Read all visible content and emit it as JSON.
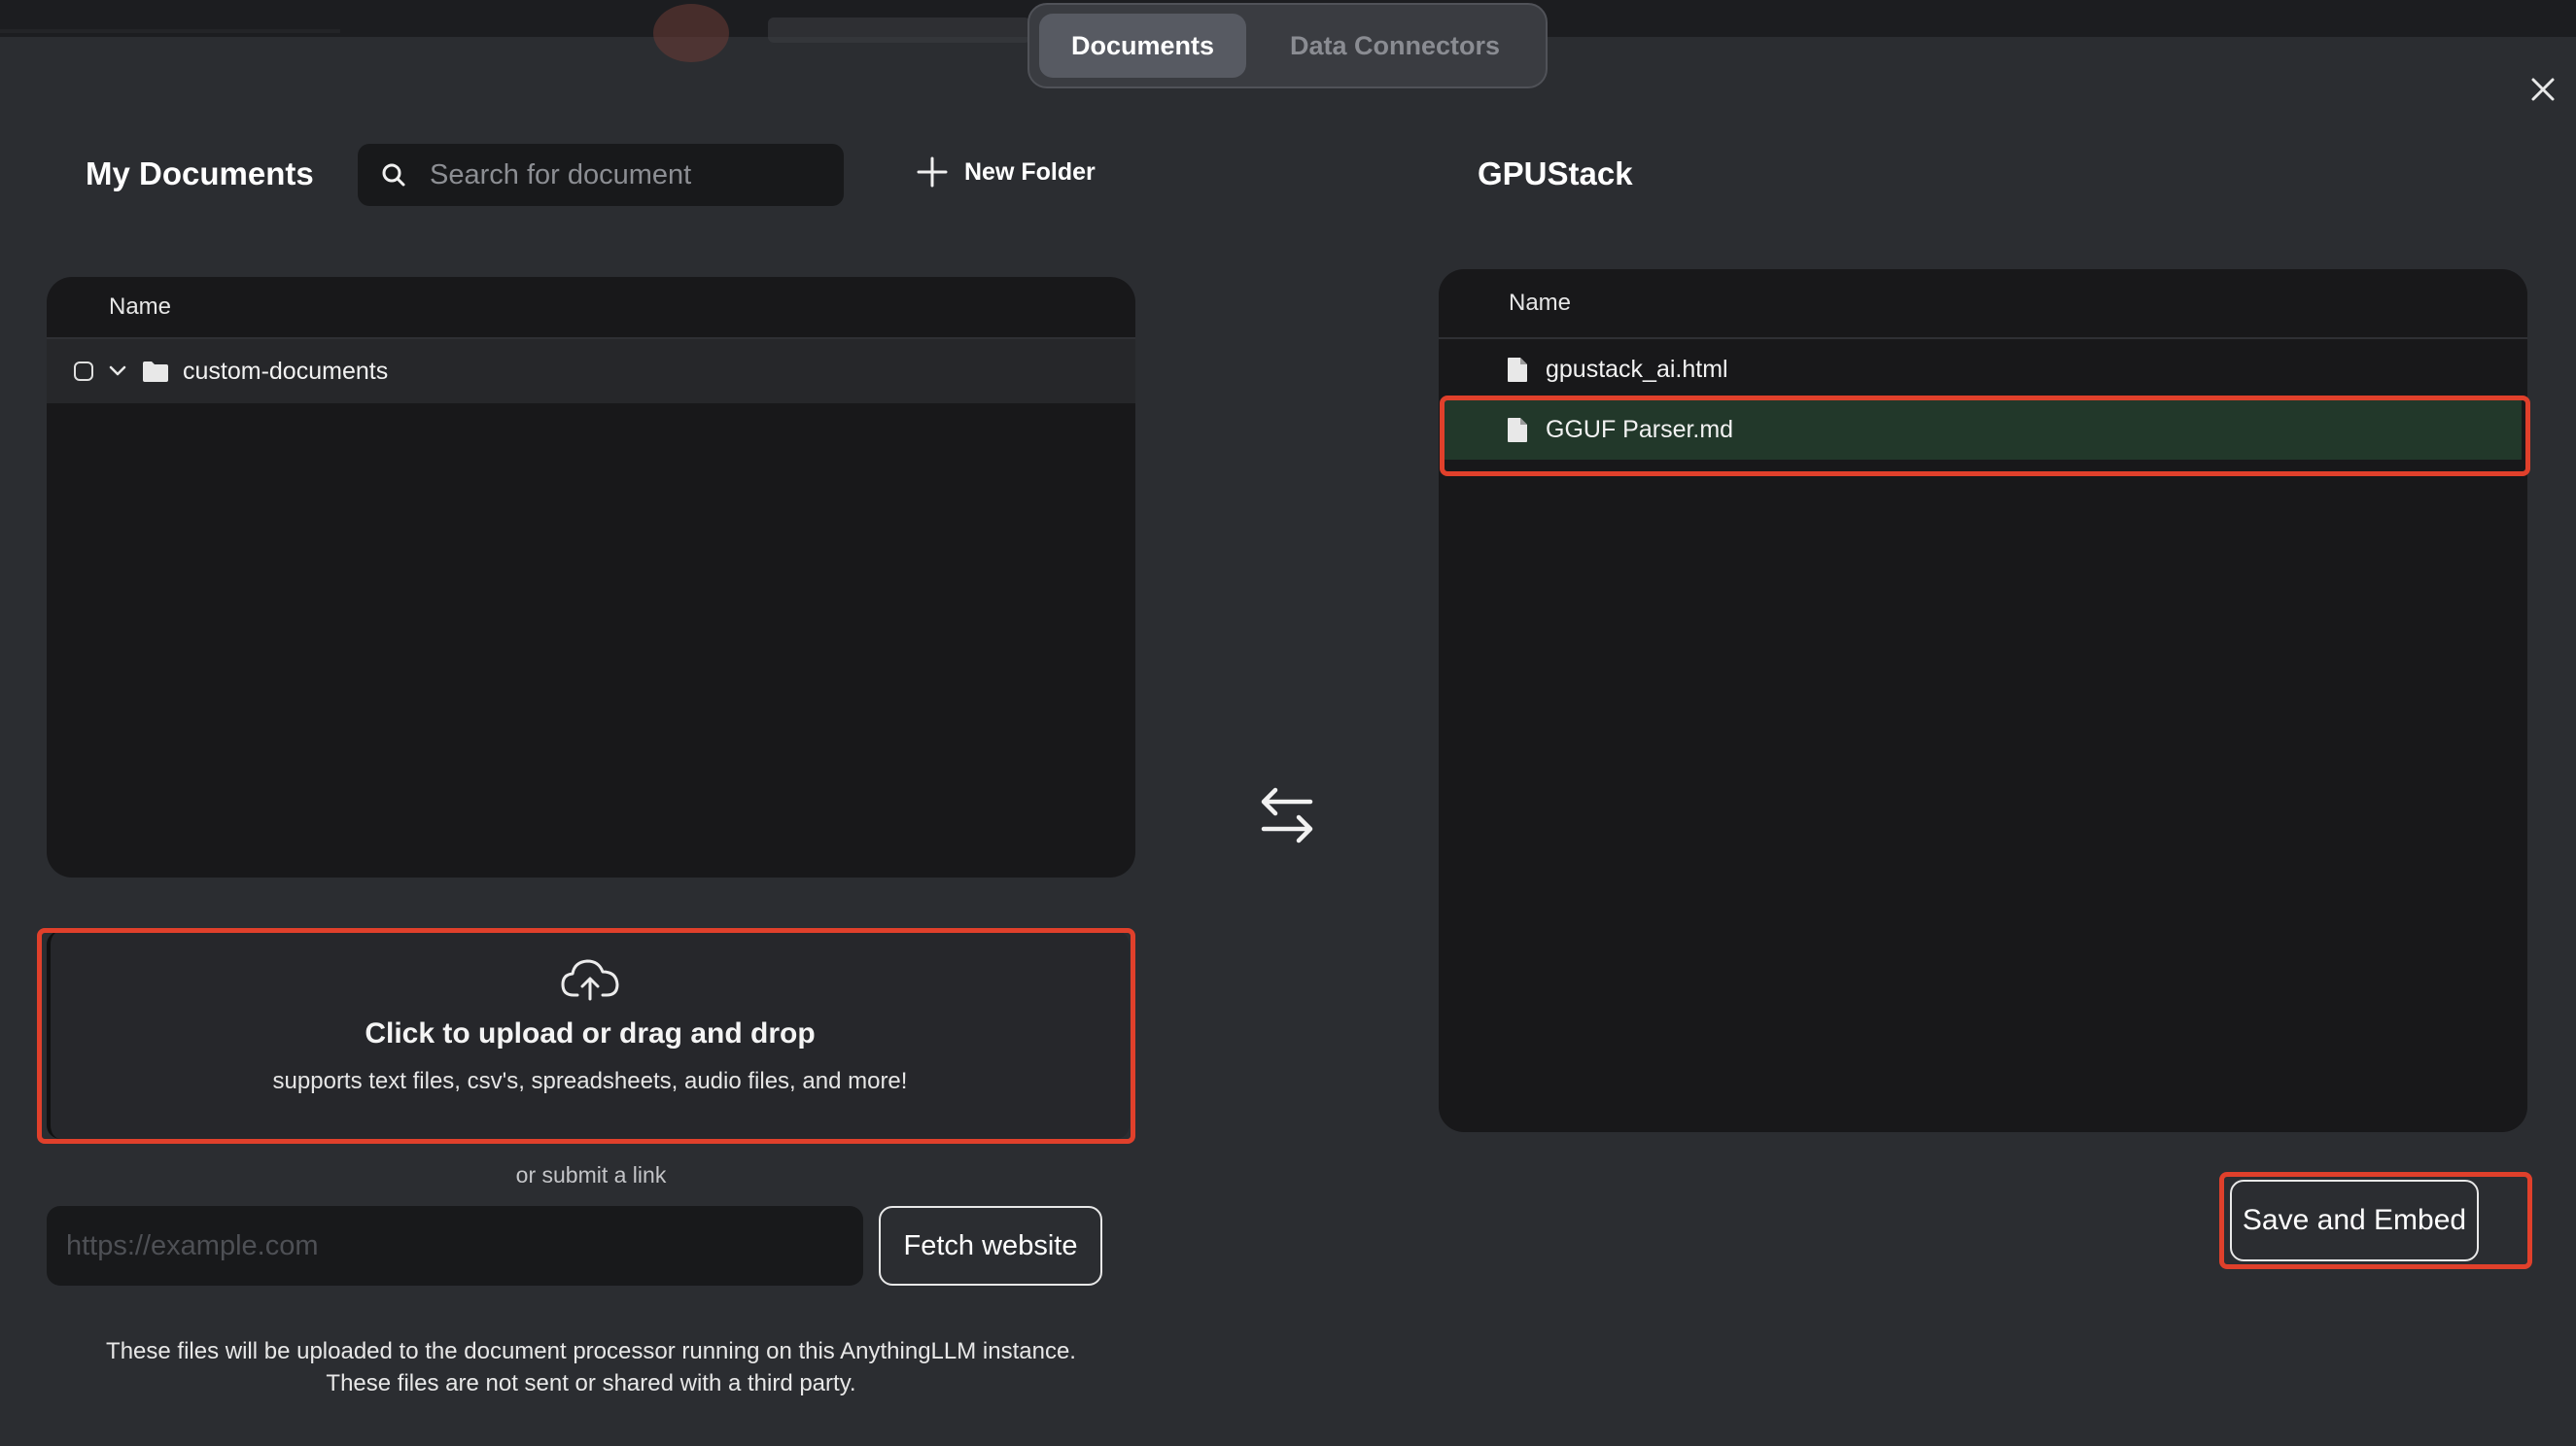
{
  "tabs": [
    {
      "label": "Documents",
      "active": true
    },
    {
      "label": "Data Connectors",
      "active": false
    }
  ],
  "left": {
    "title": "My Documents",
    "search_placeholder": "Search for document",
    "new_folder_label": "New Folder",
    "column_name": "Name",
    "folders": [
      {
        "name": "custom-documents",
        "checked": false,
        "expanded": true
      }
    ]
  },
  "upload": {
    "title": "Click to upload or drag and drop",
    "subtitle": "supports text files, csv's, spreadsheets, audio files, and more!",
    "or_link": "or submit a link",
    "url_placeholder": "https://example.com",
    "fetch_label": "Fetch website",
    "disclaimer_line1": "These files will be uploaded to the document processor running on this AnythingLLM instance.",
    "disclaimer_line2": "These files are not sent or shared with a third party."
  },
  "right": {
    "title": "GPUStack",
    "column_name": "Name",
    "files": [
      {
        "name": "gpustack_ai.html",
        "selected": false
      },
      {
        "name": "GGUF Parser.md",
        "selected": true
      }
    ],
    "save_label": "Save and Embed"
  },
  "colors": {
    "background": "#2b2d31",
    "panel": "#18181a",
    "selected_row": "#22382a",
    "highlight": "#e0402b"
  }
}
